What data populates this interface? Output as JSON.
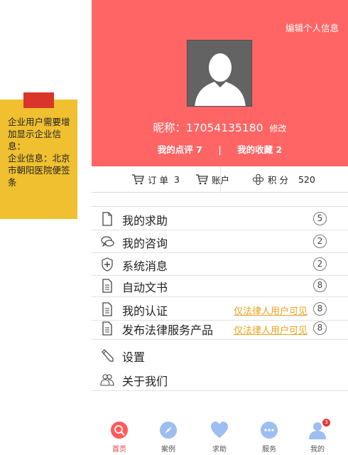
{
  "sticky_note": {
    "lines": [
      "企业用户需要增加显示企业信息：",
      "企业信息：北京市朝阳医院便签条"
    ]
  },
  "profile": {
    "edit_label": "编辑个人信息",
    "nickname": "昵称：17054135180",
    "modify_label": "修改",
    "reviews_label": "我的点评 7",
    "separator": "|",
    "favorites_label": "我的收藏 2"
  },
  "bar": {
    "orders_label": "订 单",
    "orders_count": "3",
    "account_label": "账户",
    "points_label": "积 分",
    "points_value": "520"
  },
  "menu": [
    {
      "name": "my-help-requests",
      "icon": "document-icon",
      "label": "我的求助",
      "badge": "5"
    },
    {
      "name": "my-consultations",
      "icon": "chat-bubbles-icon",
      "label": "我的咨询",
      "badge": "2"
    },
    {
      "name": "system-messages",
      "icon": "shield-plus-icon",
      "label": "系统消息",
      "badge": "2"
    },
    {
      "name": "auto-documents",
      "icon": "document-lines-icon",
      "label": "自动文书",
      "badge": "8"
    },
    {
      "name": "my-certification",
      "icon": "document-lines-icon",
      "label": "我的认证",
      "note": "仅法律人用户可见",
      "badge": "8"
    },
    {
      "name": "publish-legal-services",
      "icon": "document-lines-icon",
      "label": "发布法律服务产品",
      "note": "仅法律人用户可见",
      "badge": "8"
    },
    {
      "name": "settings",
      "icon": "pencil-icon",
      "label": "设置"
    },
    {
      "name": "about-us",
      "icon": "people-icon",
      "label": "关于我们"
    }
  ],
  "tabs": [
    {
      "name": "home",
      "label": "首页",
      "icon": "search-circle-icon",
      "color": "#ff5a5a",
      "active": true
    },
    {
      "name": "cases",
      "label": "案例",
      "icon": "compass-icon",
      "color": "#9dbef0"
    },
    {
      "name": "help",
      "label": "求助",
      "icon": "heart-icon",
      "color": "#9dbef0"
    },
    {
      "name": "services",
      "label": "服务",
      "icon": "chat-dots-icon",
      "color": "#9dbef0"
    },
    {
      "name": "mine",
      "label": "我的",
      "icon": "user-icon",
      "color": "#9dbef0",
      "badge": "3"
    }
  ],
  "colors": {
    "header_bg": "#ff6565",
    "sticky_bg": "#f0c030",
    "sticky_tab": "#d9352a",
    "note_text": "#e8a41e",
    "active_tab": "#e24040"
  }
}
